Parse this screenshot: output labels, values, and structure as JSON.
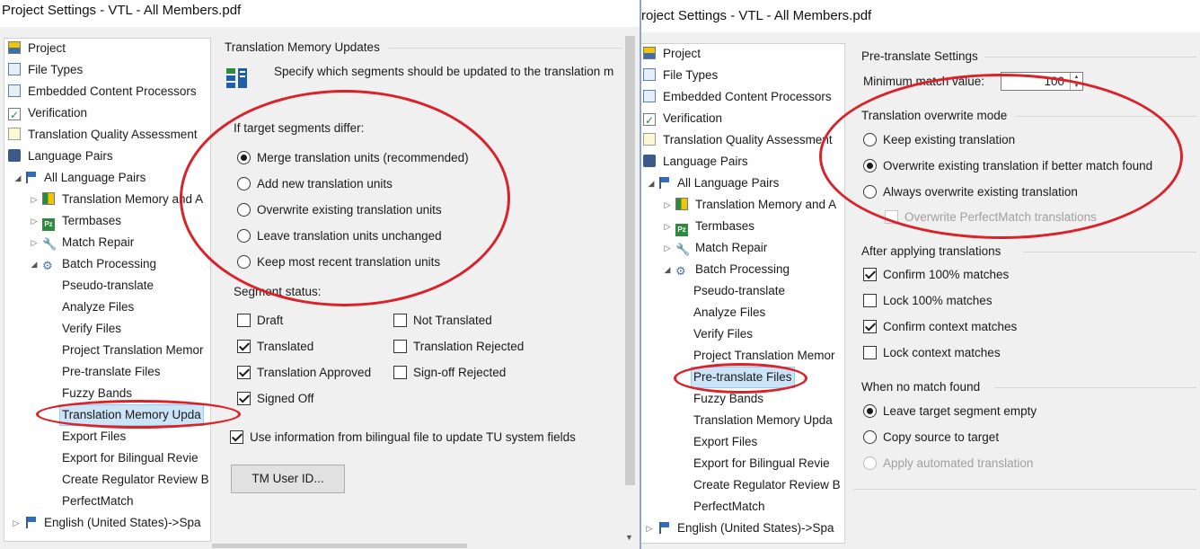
{
  "left": {
    "title": "Project Settings - VTL - All Members.pdf",
    "tree": [
      {
        "label": "Project"
      },
      {
        "label": "File Types"
      },
      {
        "label": "Embedded Content Processors"
      },
      {
        "label": "Verification"
      },
      {
        "label": "Translation Quality Assessment"
      },
      {
        "label": "Language Pairs"
      },
      {
        "label": "All Language Pairs"
      },
      {
        "label": "Translation Memory and A"
      },
      {
        "label": "Termbases"
      },
      {
        "label": "Match Repair"
      },
      {
        "label": "Batch Processing"
      },
      {
        "label": "Pseudo-translate"
      },
      {
        "label": "Analyze Files"
      },
      {
        "label": "Verify Files"
      },
      {
        "label": "Project Translation Memor"
      },
      {
        "label": "Pre-translate Files"
      },
      {
        "label": "Fuzzy Bands"
      },
      {
        "label": "Translation Memory Upda"
      },
      {
        "label": "Export Files"
      },
      {
        "label": "Export for Bilingual Revie"
      },
      {
        "label": "Create Regulator Review B"
      },
      {
        "label": "PerfectMatch"
      },
      {
        "label": "English (United States)->Spa"
      }
    ],
    "panel": {
      "title": "Translation Memory Updates",
      "description": "Specify which segments should be updated to the translation m",
      "differ_title": "If target segments differ:",
      "differ_options": [
        {
          "label": "Merge translation units (recommended)"
        },
        {
          "label": "Add new translation units"
        },
        {
          "label": "Overwrite existing translation units"
        },
        {
          "label": "Leave translation units unchanged"
        },
        {
          "label": "Keep most recent translation units"
        }
      ],
      "status_title": "Segment status:",
      "status_left": [
        {
          "label": "Draft"
        },
        {
          "label": "Translated"
        },
        {
          "label": "Translation Approved"
        },
        {
          "label": "Signed Off"
        }
      ],
      "status_right": [
        {
          "label": "Not Translated"
        },
        {
          "label": "Translation Rejected"
        },
        {
          "label": "Sign-off Rejected"
        }
      ],
      "bilingual_label": "Use information from bilingual file to update TU system fields",
      "tm_user_button": "TM User ID..."
    }
  },
  "right": {
    "title": "Project Settings - VTL - All Members.pdf",
    "tree": [
      {
        "label": "Project"
      },
      {
        "label": "File Types"
      },
      {
        "label": "Embedded Content Processors"
      },
      {
        "label": "Verification"
      },
      {
        "label": "Translation Quality Assessment"
      },
      {
        "label": "Language Pairs"
      },
      {
        "label": "All Language Pairs"
      },
      {
        "label": "Translation Memory and A"
      },
      {
        "label": "Termbases"
      },
      {
        "label": "Match Repair"
      },
      {
        "label": "Batch Processing"
      },
      {
        "label": "Pseudo-translate"
      },
      {
        "label": "Analyze Files"
      },
      {
        "label": "Verify Files"
      },
      {
        "label": "Project Translation Memor"
      },
      {
        "label": "Pre-translate Files"
      },
      {
        "label": "Fuzzy Bands"
      },
      {
        "label": "Translation Memory Upda"
      },
      {
        "label": "Export Files"
      },
      {
        "label": "Export for Bilingual Revie"
      },
      {
        "label": "Create Regulator Review B"
      },
      {
        "label": "PerfectMatch"
      },
      {
        "label": "English (United States)->Spa"
      }
    ],
    "panel": {
      "title": "Pre-translate Settings",
      "min_match_label": "Minimum match value:",
      "min_match_value": "100",
      "overwrite_title": "Translation overwrite mode",
      "overwrite_options": [
        {
          "label": "Keep existing translation"
        },
        {
          "label": "Overwrite existing translation if better match found"
        },
        {
          "label": "Always overwrite existing translation"
        }
      ],
      "perfectmatch_label": "Overwrite PerfectMatch translations",
      "after_title": "After applying translations",
      "after_options": [
        {
          "label": "Confirm 100% matches"
        },
        {
          "label": "Lock 100% matches"
        },
        {
          "label": "Confirm context matches"
        },
        {
          "label": "Lock context matches"
        }
      ],
      "nomatch_title": "When no match found",
      "nomatch_options": [
        {
          "label": "Leave target segment empty"
        },
        {
          "label": "Copy source to target"
        },
        {
          "label": "Apply automated translation"
        }
      ]
    }
  },
  "colors": {
    "annotation": "#d9222a",
    "selection": "#cce4f7",
    "window_bg": "#f0f0f0"
  }
}
